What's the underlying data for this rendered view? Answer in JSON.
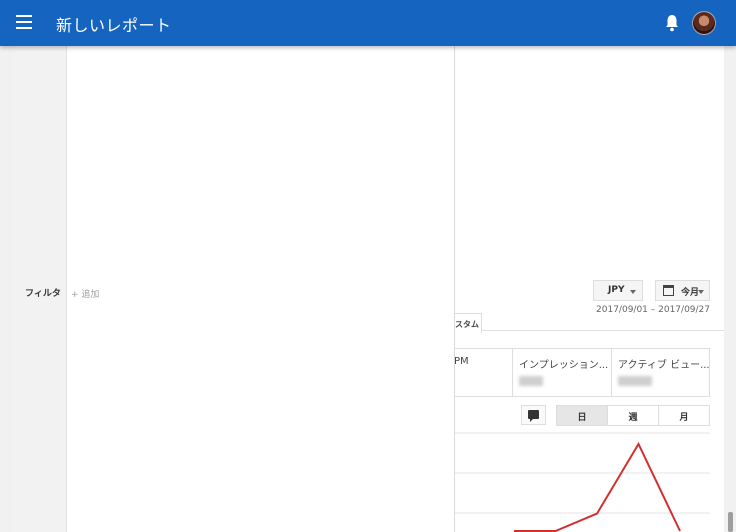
{
  "header": {
    "title": "新しいレポート",
    "menu_icon": "menu-icon",
    "notifications_icon": "bell-icon",
    "avatar_icon": "avatar"
  },
  "filter": {
    "label": "フィルタ",
    "add_label": "+ 追加"
  },
  "controls": {
    "currency": "JPY",
    "period": "今月",
    "date_range": "2017/09/01 – 2017/09/27"
  },
  "tabs": {
    "custom_partial": "スタム"
  },
  "metrics": [
    {
      "title": "PM"
    },
    {
      "title": "インプレッション..."
    },
    {
      "title": "アクティブ ビュー..."
    }
  ],
  "granularity": {
    "day": "日",
    "week": "週",
    "month": "月",
    "active": "day"
  },
  "chart_data": {
    "type": "line",
    "series_color": "#d32f2f",
    "grid": true,
    "values": [
      null,
      null,
      null,
      0,
      0,
      0.2,
      1.0,
      0
    ]
  },
  "colors": {
    "header_bg": "#1565c0",
    "accent_line": "#d32f2f"
  }
}
